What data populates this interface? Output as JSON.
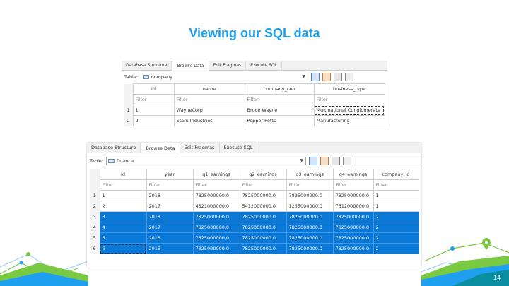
{
  "slide": {
    "title": "Viewing our SQL data",
    "page_number": "14"
  },
  "window_top": {
    "tabs": [
      "Database Structure",
      "Browse Data",
      "Edit Pragmas",
      "Execute SQL"
    ],
    "active_tab": "Browse Data",
    "table_label": "Table:",
    "table_value": "company",
    "columns": [
      "id",
      "name",
      "company_ceo",
      "business_type"
    ],
    "filter_placeholder": "Filter",
    "rows": [
      {
        "num": "1",
        "cells": [
          "1",
          "WayneCorp",
          "Bruce Wayne",
          "Multinational Conglomerate"
        ]
      },
      {
        "num": "2",
        "cells": [
          "2",
          "Stark Industries",
          "Pepper Potts",
          "Manufacturing"
        ]
      }
    ]
  },
  "window_bottom": {
    "tabs": [
      "Database Structure",
      "Browse Data",
      "Edit Pragmas",
      "Execute SQL"
    ],
    "active_tab": "Browse Data",
    "table_label": "Table:",
    "table_value": "finance",
    "columns": [
      "id",
      "year",
      "q1_earnings",
      "q2_earnings",
      "q3_earnings",
      "q4_earnings",
      "company_id"
    ],
    "filter_placeholder": "Filter",
    "rows": [
      {
        "num": "1",
        "selected": false,
        "cells": [
          "1",
          "2018",
          "7825000000.0",
          "7825000000.0",
          "7825000000.0",
          "7825000000.0",
          "1"
        ]
      },
      {
        "num": "2",
        "selected": false,
        "cells": [
          "2",
          "2017",
          "4321000000.0",
          "5412000000.0",
          "1255000000.0",
          "7612000000.0",
          "1"
        ]
      },
      {
        "num": "3",
        "selected": true,
        "cells": [
          "3",
          "2018",
          "7825000000.0",
          "7825000000.0",
          "7825000000.0",
          "7825000000.0",
          "2"
        ]
      },
      {
        "num": "4",
        "selected": true,
        "cells": [
          "4",
          "2017",
          "7825000000.0",
          "7825000000.0",
          "7825000000.0",
          "7825000000.0",
          "2"
        ]
      },
      {
        "num": "5",
        "selected": true,
        "cells": [
          "5",
          "2016",
          "7825000000.0",
          "7825000000.0",
          "7825000000.0",
          "7825000000.0",
          "2"
        ]
      },
      {
        "num": "6",
        "selected": true,
        "cells": [
          "6",
          "2015",
          "7825000000.0",
          "7825000000.0",
          "7825000000.0",
          "7825000000.0",
          "2"
        ]
      }
    ]
  },
  "colors": {
    "title": "#1f9ff0",
    "selection": "#0a78d7",
    "deco_green": "#7ac943",
    "deco_blue": "#1f9ff0",
    "deco_teal": "#0b8fa0"
  },
  "icons": [
    "table-icon",
    "refresh-icon",
    "clear-filters-icon",
    "new-record-icon",
    "delete-record-icon",
    "location-pin-icon"
  ]
}
